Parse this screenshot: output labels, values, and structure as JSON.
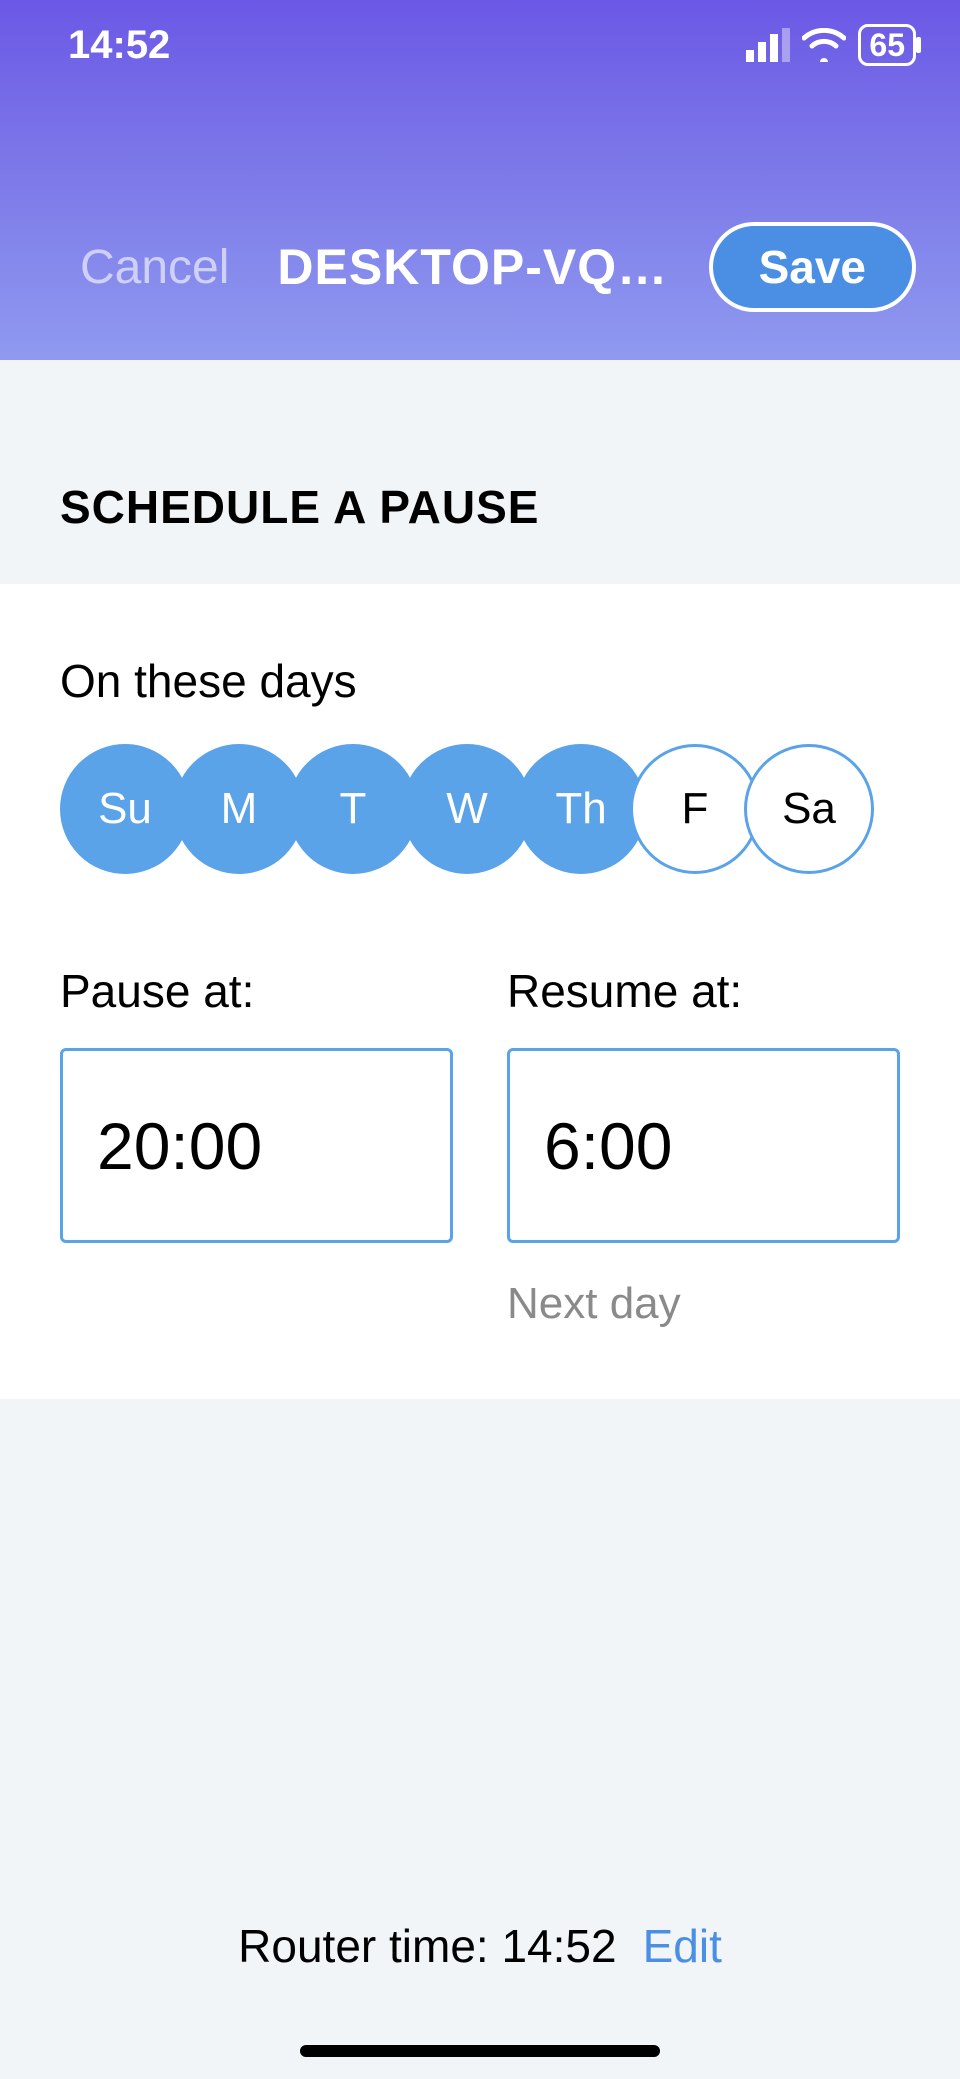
{
  "status": {
    "time": "14:52",
    "battery": "65"
  },
  "header": {
    "cancel": "Cancel",
    "title": "DESKTOP-VQ…",
    "save": "Save"
  },
  "section_heading": "SCHEDULE A PAUSE",
  "days": {
    "label": "On these days",
    "items": [
      {
        "abbrev": "Su",
        "selected": true
      },
      {
        "abbrev": "M",
        "selected": true
      },
      {
        "abbrev": "T",
        "selected": true
      },
      {
        "abbrev": "W",
        "selected": true
      },
      {
        "abbrev": "Th",
        "selected": true
      },
      {
        "abbrev": "F",
        "selected": false
      },
      {
        "abbrev": "Sa",
        "selected": false
      }
    ]
  },
  "pause": {
    "label": "Pause at:",
    "value": "20:00"
  },
  "resume": {
    "label": "Resume at:",
    "value": "6:00",
    "note": "Next day"
  },
  "footer": {
    "router_time_label": "Router time: 14:52",
    "edit": "Edit"
  }
}
